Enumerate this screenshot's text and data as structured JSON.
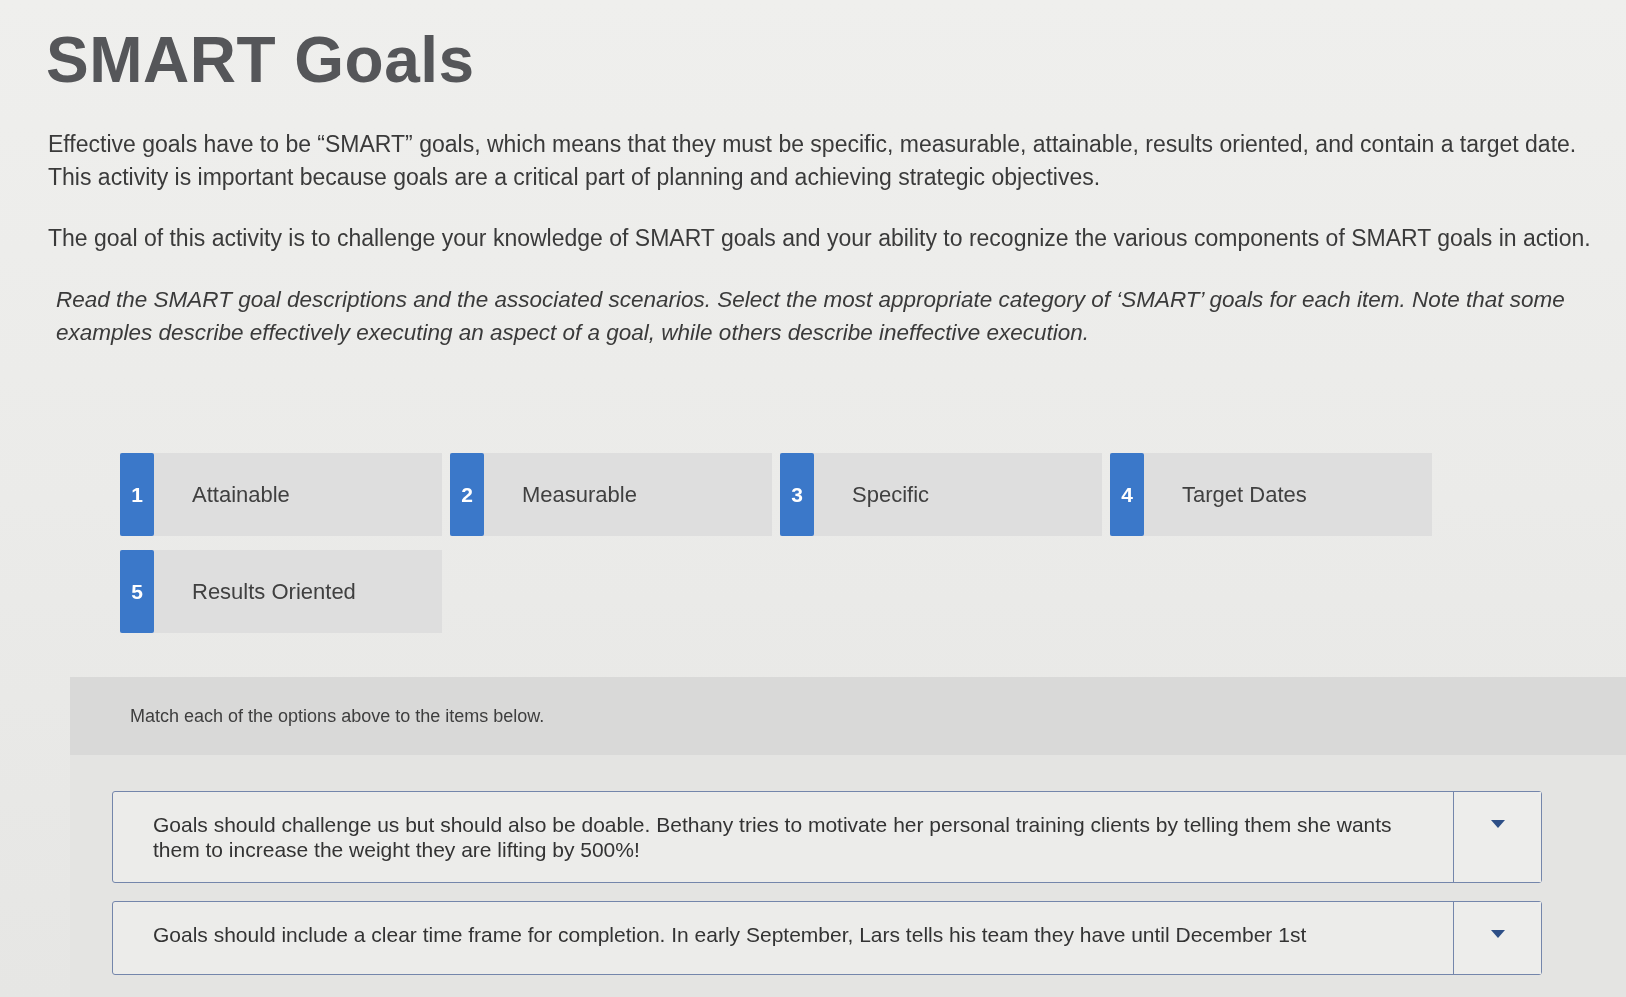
{
  "title": "SMART Goals",
  "paragraphs": [
    {
      "kind": "plain",
      "text": "Effective goals have to be “SMART” goals, which means that they must be specific, measurable, attainable, results oriented, and contain a target date. This activity is important because goals are a critical part of planning and achieving strategic objectives."
    },
    {
      "kind": "plain",
      "text": "The goal of this activity is to challenge your knowledge of SMART goals and your ability to recognize the various components of SMART goals in action."
    },
    {
      "kind": "instruction",
      "text": "Read the SMART goal descriptions and the associated scenarios. Select the most appropriate category of ‘SMART’ goals for each item. Note that some examples describe effectively executing an aspect of a goal, while others describe ineffective execution."
    }
  ],
  "options": [
    {
      "number": "1",
      "label": "Attainable"
    },
    {
      "number": "2",
      "label": "Measurable"
    },
    {
      "number": "3",
      "label": "Specific"
    },
    {
      "number": "4",
      "label": "Target Dates"
    },
    {
      "number": "5",
      "label": "Results Oriented"
    }
  ],
  "match_panel": {
    "instruction": "Match each of the options above to the items below.",
    "items": [
      {
        "text": "Goals should challenge us but should also be doable. Bethany tries to motivate her personal training clients by telling them she wants them to increase the weight they are lifting by 500%!"
      },
      {
        "text": "Goals should include a clear time frame for completion. In early September, Lars tells his team they have until December 1st"
      }
    ]
  }
}
